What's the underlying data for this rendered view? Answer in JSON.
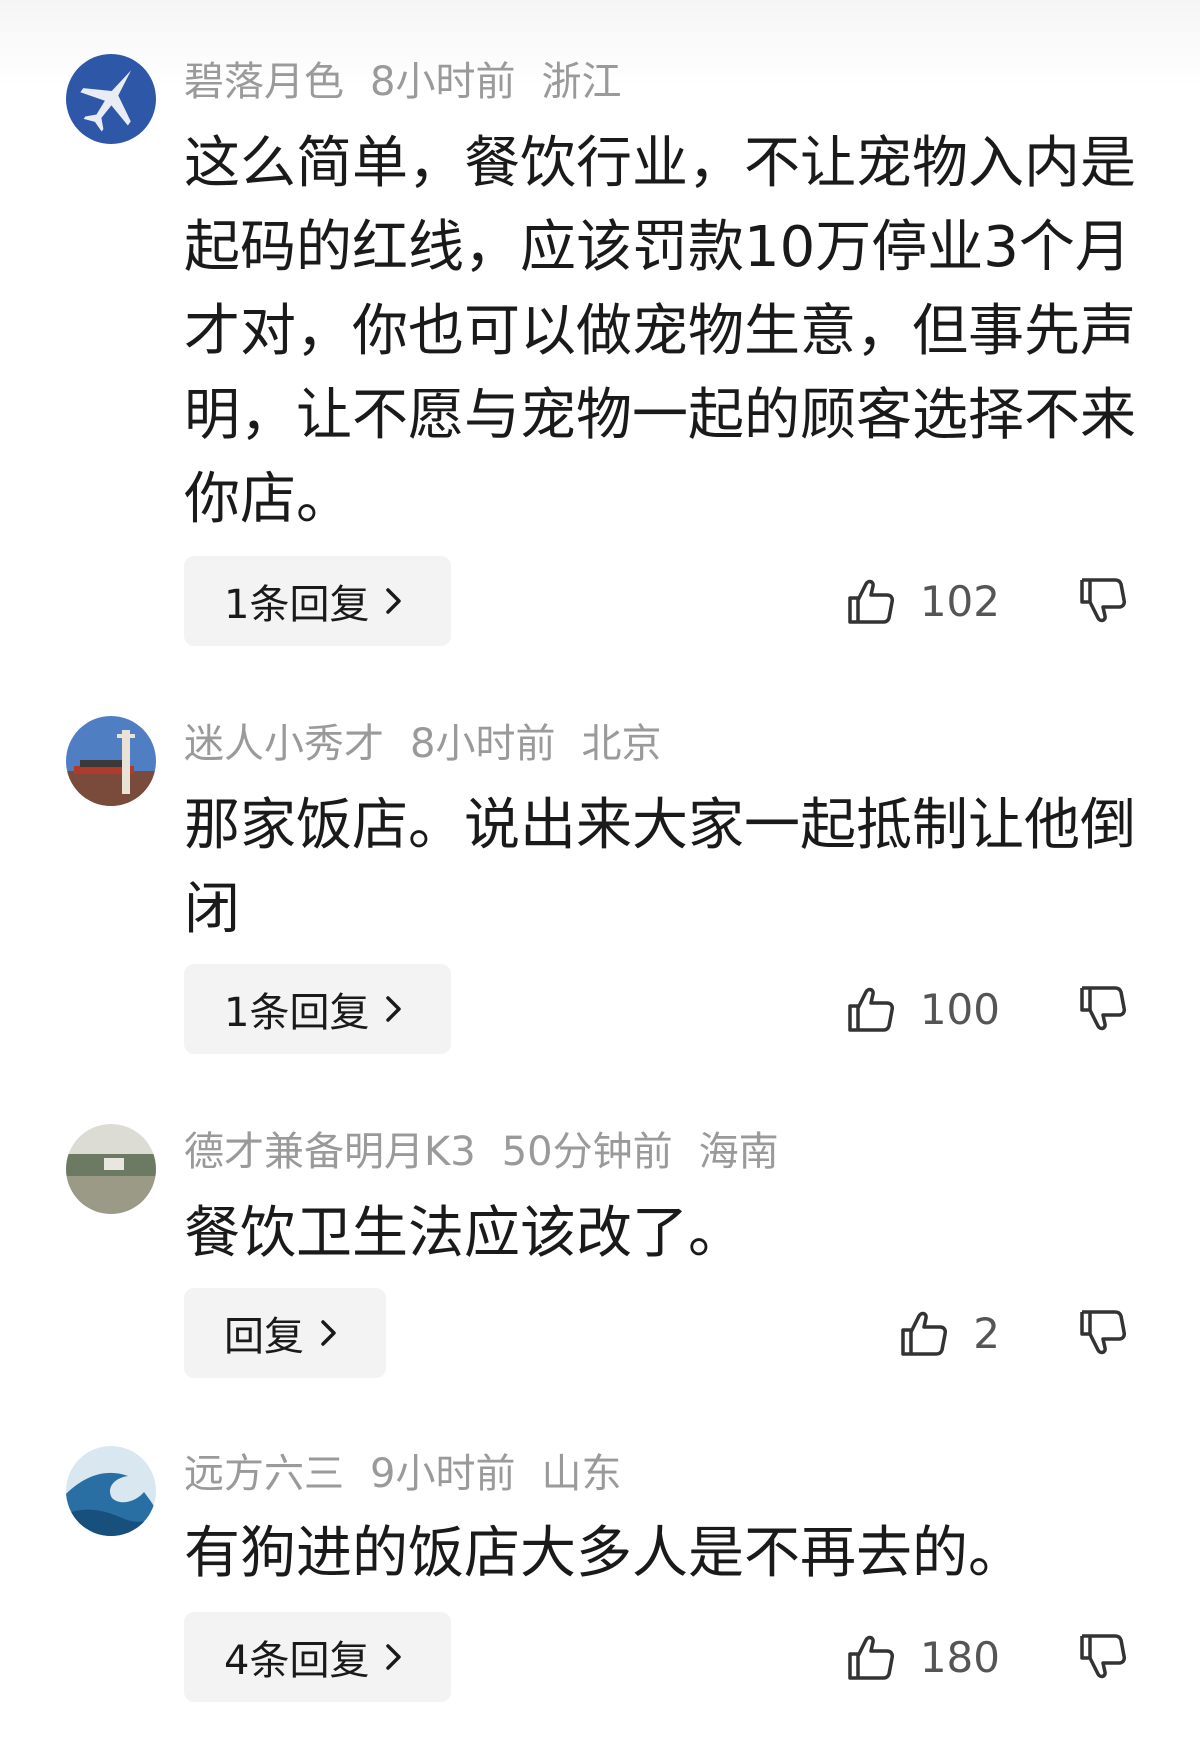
{
  "comments": [
    {
      "username": "碧落月色",
      "time": "8小时前",
      "location": "浙江",
      "text": "这么简单，餐饮行业，不让宠物入内是起码的红线，应该罚款10万停业3个月才对，你也可以做宠物生意，但事先声明，让不愿与宠物一起的顾客选择不来你店。",
      "reply_label": "1条回复",
      "likes": "102",
      "avatar_icon": "fighter-jet-avatar"
    },
    {
      "username": "迷人小秀才",
      "time": "8小时前",
      "location": "北京",
      "text": "那家饭店。说出来大家一起抵制让他倒闭",
      "reply_label": "1条回复",
      "likes": "100",
      "avatar_icon": "tiananmen-avatar"
    },
    {
      "username": "德才兼备明月K3",
      "time": "50分钟前",
      "location": "海南",
      "text": "餐饮卫生法应该改了。",
      "reply_label": "回复",
      "likes": "2",
      "avatar_icon": "lake-landscape-avatar"
    },
    {
      "username": "远方六三",
      "time": "9小时前",
      "location": "山东",
      "text": "有狗进的饭店大多人是不再去的。",
      "reply_label": "4条回复",
      "likes": "180",
      "avatar_icon": "ocean-wave-avatar"
    }
  ],
  "icons": {
    "like": "thumbs-up-icon",
    "dislike": "thumbs-down-icon",
    "reply_arrow": "chevron-right-icon"
  },
  "colors": {
    "meta_text": "#9a9a9a",
    "body_text": "#1a1a1a",
    "reply_bg": "#f3f3f3",
    "icon": "#333333"
  }
}
